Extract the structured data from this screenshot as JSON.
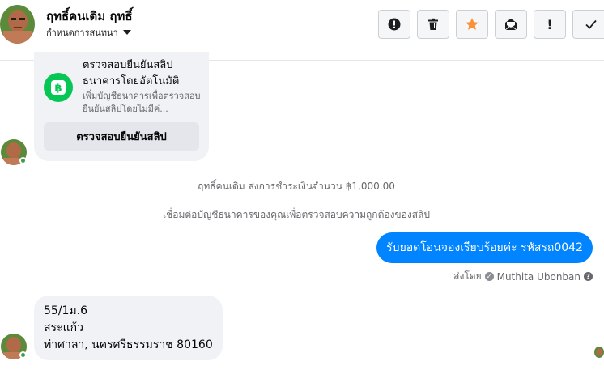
{
  "header": {
    "contact_name": "ฤทธิ์คนเดิม ฤทธิ์",
    "subtitle": "กำหนดการสนทนา",
    "actions": [
      {
        "name": "alert-circle-icon"
      },
      {
        "name": "trash-icon"
      },
      {
        "name": "star-icon",
        "color": "#f7923a"
      },
      {
        "name": "mark-unread-icon"
      },
      {
        "name": "exclamation-icon",
        "label": "!"
      },
      {
        "name": "check-icon"
      }
    ]
  },
  "slip_card": {
    "title": "ตรวจสอบยืนยันสลิปธนาคารโดยอัตโนมัติ",
    "description": "เพิ่มบัญชีธนาคารเพื่อตรวจสอบยืนยันสลิปโดยไม่มีค่...",
    "button_label": "ตรวจสอบยืนยันสลิป"
  },
  "system_messages": [
    "ฤทธิ์คนเดิม ส่งการชำระเงินจำนวน ฿1,000.00",
    "เชื่อมต่อบัญชีธนาคารของคุณเพื่อตรวจสอบความถูกต้องของสลิป"
  ],
  "outgoing": {
    "text": "รับยอดโอนจองเรียบร้อยค่ะ รหัสรถ0042",
    "sent_by_prefix": "ส่งโดย",
    "sender_name": "Muthita Ubonban",
    "help_glyph": "?"
  },
  "incoming": {
    "lines": [
      "55/1ม.6",
      "สระแก้ว",
      "ท่าศาลา, นครศรีธรรมราช 80160"
    ]
  },
  "colors": {
    "accent": "#0084ff",
    "star": "#f7923a",
    "online": "#31a24c",
    "bank_logo": "#06c755"
  }
}
